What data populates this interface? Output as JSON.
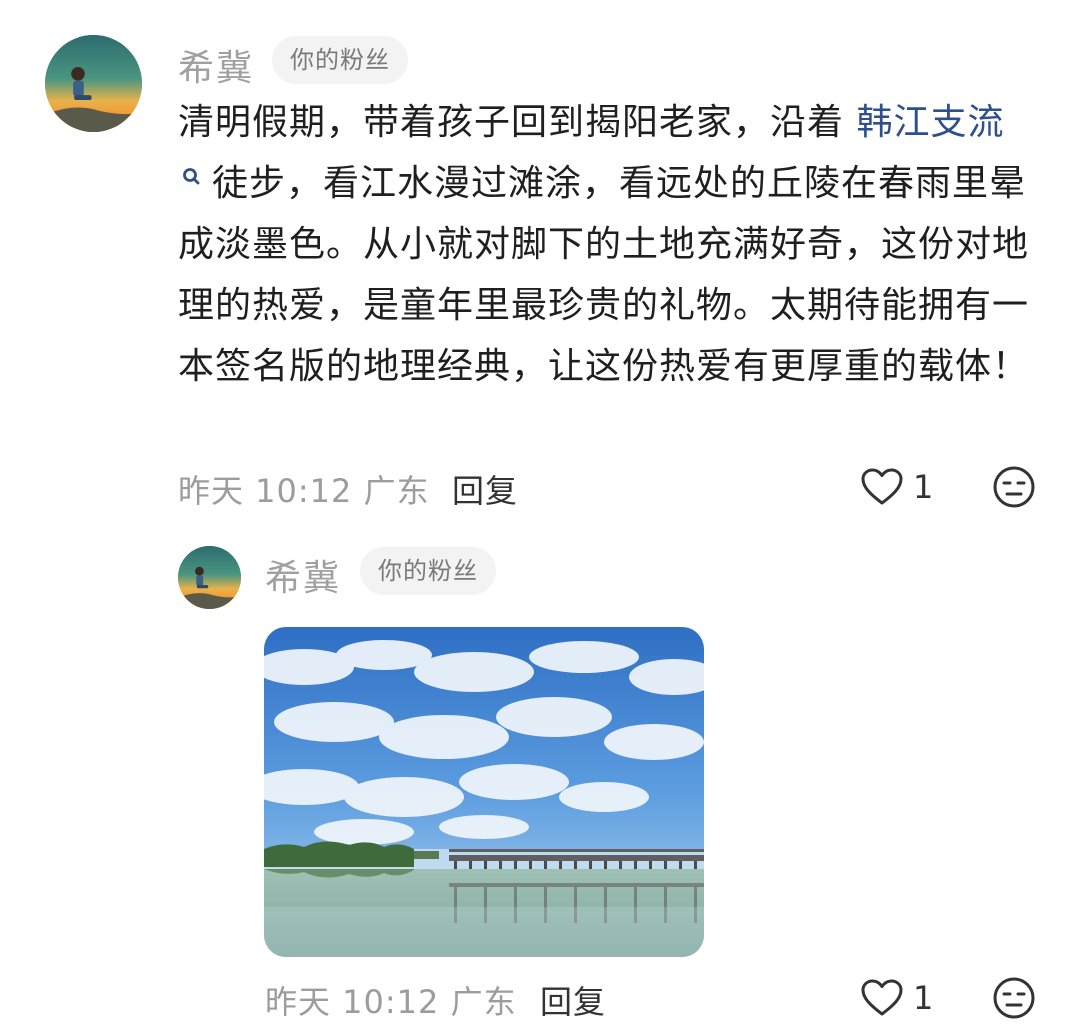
{
  "comments": [
    {
      "username": "希冀",
      "badge": "你的粉丝",
      "text_before": "清明假期，带着孩子回到揭阳老家，沿着 ",
      "topic_link": "韩江支流",
      "text_after": "徒步，看江水漫过滩涂，看远处的丘陵在春雨里晕成淡墨色。从小就对脚下的土地充满好奇，这份对地理的热爱，是童年里最珍贵的礼物。太期待能拥有一本签名版的地理经典，让这份热爱有更厚重的载体！",
      "time": "昨天 10:12",
      "location": "广东",
      "reply_label": "回复",
      "like_count": "1",
      "icons": {
        "avatar": "avatar-image",
        "link": "search-icon",
        "like": "heart-icon",
        "emoji": "meh-face-icon"
      }
    },
    {
      "username": "希冀",
      "badge": "你的粉丝",
      "image": "river-photo",
      "time": "昨天 10:12",
      "location": "广东",
      "reply_label": "回复",
      "like_count": "1",
      "icons": {
        "avatar": "avatar-image",
        "like": "heart-icon",
        "emoji": "meh-face-icon"
      }
    }
  ],
  "colors": {
    "link": "#2d4f8c",
    "meta": "#9c9c9c",
    "badge_bg": "#f3f3f3"
  }
}
